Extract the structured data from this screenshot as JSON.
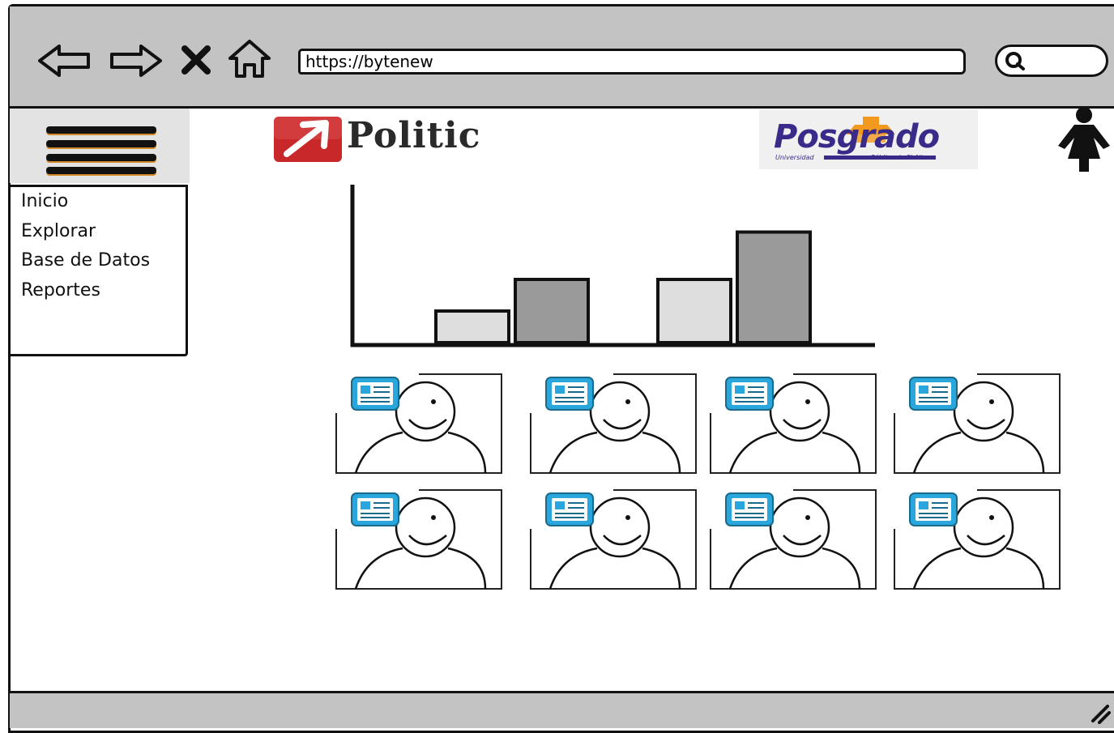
{
  "browser": {
    "url": "https://bytenew",
    "nav_icons": [
      "back-arrow-icon",
      "forward-arrow-icon",
      "close-icon",
      "home-icon"
    ],
    "search_icon": "search-icon"
  },
  "header": {
    "menu_icon": "hamburger-menu-icon",
    "app_name": "Politic",
    "partner_logo": {
      "title": "Posgrado",
      "subtitle_left": "Universidad",
      "subtitle_right": "Pública de El Alto"
    },
    "user_icon": "user-icon"
  },
  "sidebar": {
    "items": [
      {
        "label": "Inicio"
      },
      {
        "label": "Explorar"
      },
      {
        "label": "Base de Datos"
      },
      {
        "label": "Reportes"
      }
    ]
  },
  "chart_data": {
    "type": "bar",
    "categories": [
      "",
      ""
    ],
    "series": [
      {
        "values": [
          2,
          4
        ],
        "color": "#dedede"
      },
      {
        "values": [
          4,
          7
        ],
        "color": "#9a9a9a"
      }
    ],
    "ylim": [
      0,
      10
    ],
    "grid": false
  },
  "cards": {
    "count": 8,
    "image_icon": "user-placeholder-icon",
    "badge_icon": "profile-card-icon",
    "badge_color": "#29a7dc"
  },
  "colors": {
    "toolbar": "#c3c3c3",
    "politic_red": "#c8282a",
    "posgrado_blue": "#3a2a8a",
    "posgrado_orange": "#f29a1f"
  }
}
